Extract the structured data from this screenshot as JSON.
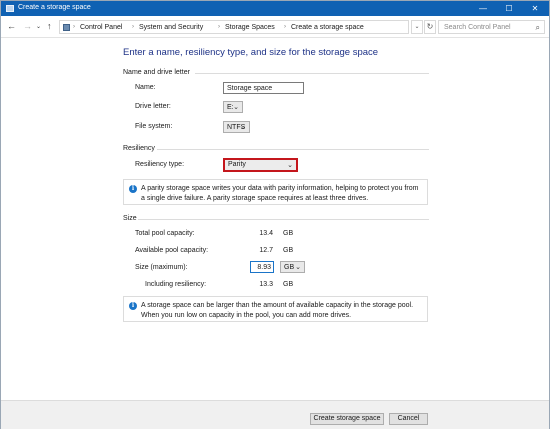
{
  "window": {
    "title": "Create a storage space",
    "controls": {
      "minimize": "—",
      "maximize": "☐",
      "close": "✕"
    }
  },
  "address_bar": {
    "breadcrumbs": [
      "Control Panel",
      "System and Security",
      "Storage Spaces",
      "Create a storage space"
    ],
    "search_placeholder": "Search Control Panel"
  },
  "main": {
    "heading": "Enter a name, resiliency type, and size for the storage space",
    "name_section": {
      "title": "Name and drive letter",
      "name_label": "Name:",
      "name_value": "Storage space",
      "drive_letter_label": "Drive letter:",
      "drive_letter_value": "E:",
      "file_system_label": "File system:",
      "file_system_value": "NTFS"
    },
    "resiliency_section": {
      "title": "Resiliency",
      "type_label": "Resiliency type:",
      "type_value": "Parity",
      "info": "A parity storage space writes your data with parity information, helping to protect you from a single drive failure. A parity storage space requires at least three drives."
    },
    "size_section": {
      "title": "Size",
      "total_label": "Total pool capacity:",
      "total_value": "13.4",
      "total_unit": "GB",
      "available_label": "Available pool capacity:",
      "available_value": "12.7",
      "available_unit": "GB",
      "size_label": "Size (maximum):",
      "size_value": "8.93",
      "size_unit": "GB",
      "including_label": "Including resiliency:",
      "including_value": "13.3",
      "including_unit": "GB",
      "info": "A storage space can be larger than the amount of available capacity in the storage pool. When you run low on capacity in the pool, you can add more drives."
    }
  },
  "footer": {
    "create_label": "Create storage space",
    "cancel_label": "Cancel"
  },
  "colors": {
    "titlebar": "#0f61b3",
    "heading": "#1e3287",
    "highlight": "#c4161c",
    "info_icon": "#1a74c8"
  }
}
